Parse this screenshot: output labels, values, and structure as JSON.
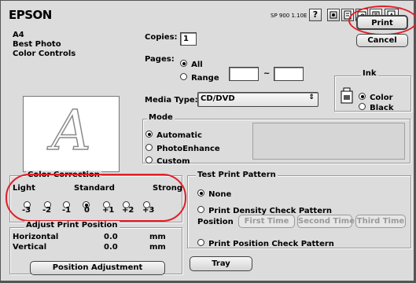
{
  "header": {
    "brand": "EPSON",
    "model": "SP 900 1.10E",
    "help": "?"
  },
  "summary": {
    "lines": [
      "A4",
      "Best Photo",
      "Color Controls"
    ]
  },
  "buttons": {
    "print": "Print",
    "cancel": "Cancel",
    "position_adjustment": "Position Adjustment",
    "tray": "Tray"
  },
  "copies": {
    "label": "Copies:",
    "value": "1"
  },
  "pages": {
    "label": "Pages:",
    "all": "All",
    "range": "Range",
    "from": "",
    "to": "",
    "separator": "~",
    "selected": "All"
  },
  "media": {
    "label": "Media Type:",
    "value": "CD/DVD"
  },
  "ink": {
    "title": "Ink",
    "color": "Color",
    "black": "Black",
    "selected": "Color"
  },
  "mode": {
    "title": "Mode",
    "options": [
      "Automatic",
      "PhotoEnhance",
      "Custom"
    ],
    "selected": "Automatic"
  },
  "color_correction": {
    "title": "Color Correction",
    "light": "Light",
    "standard": "Standard",
    "strong": "Strong",
    "values": [
      "-3",
      "-2",
      "-1",
      "0",
      "+1",
      "+2",
      "+3"
    ],
    "selected": "0"
  },
  "adjust_position": {
    "title": "Adjust Print Position",
    "horizontal": {
      "label": "Horizontal",
      "value": "0.0",
      "unit": "mm"
    },
    "vertical": {
      "label": "Vertical",
      "value": "0.0",
      "unit": "mm"
    }
  },
  "test_print": {
    "title": "Test Print Pattern",
    "none": "None",
    "density": "Print Density Check Pattern",
    "position_label": "Position",
    "first": "First Time",
    "second": "Second Time",
    "third": "Third Time",
    "position_check": "Print Position Check Pattern",
    "selected": "None"
  },
  "preview": {
    "letter": "A"
  },
  "colors": {
    "highlight_ring": "#e0202a",
    "panel": "#dcdcdc"
  }
}
